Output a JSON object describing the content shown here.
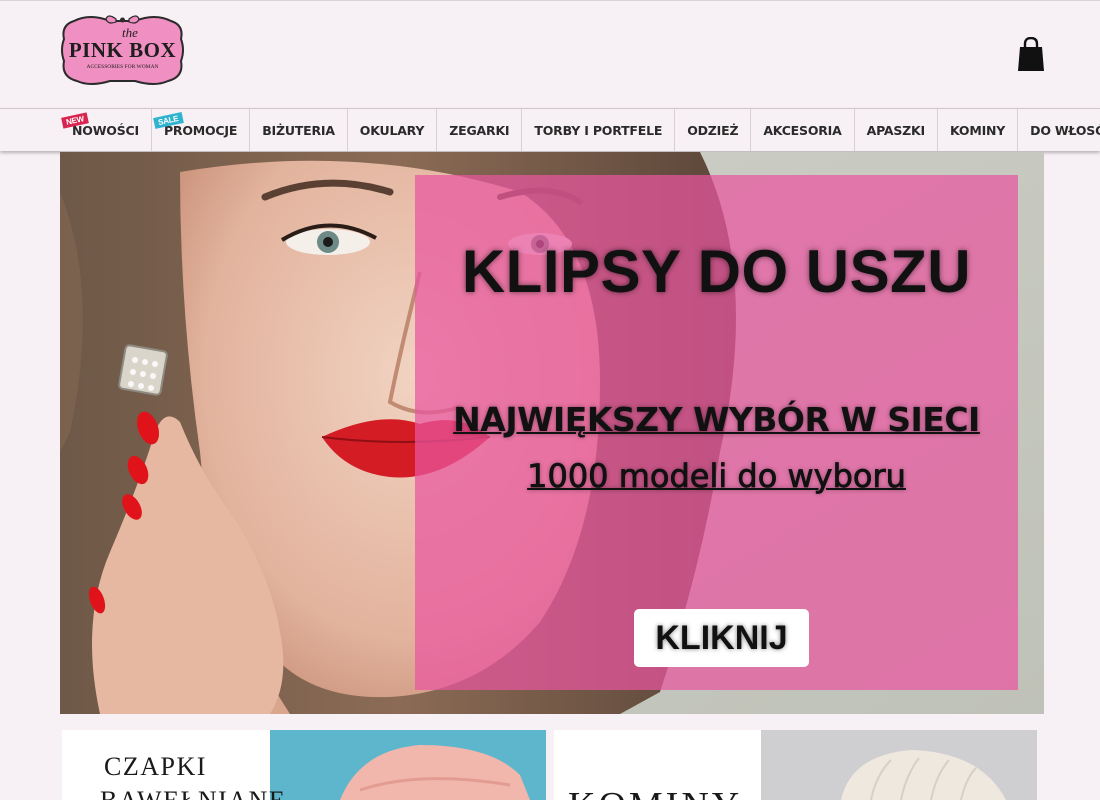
{
  "brand": {
    "logo_the": "the",
    "logo_name": "PINK BOX",
    "logo_tagline": "ACCESSORIES FOR WOMAN"
  },
  "header": {
    "cart_icon": "shopping-bag-icon"
  },
  "nav": {
    "items": [
      {
        "label": "NOWOŚCI",
        "badge": "NEW"
      },
      {
        "label": "PROMOCJE",
        "badge": "SALE"
      },
      {
        "label": "BIŻUTERIA"
      },
      {
        "label": "OKULARY"
      },
      {
        "label": "ZEGARKI"
      },
      {
        "label": "TORBY I PORTFELE"
      },
      {
        "label": "ODZIEŻ"
      },
      {
        "label": "AKCESORIA"
      },
      {
        "label": "APASZKI"
      },
      {
        "label": "KOMINY"
      },
      {
        "label": "DO WŁOSÓW"
      }
    ]
  },
  "hero": {
    "title": "KLIPSY DO USZU",
    "subtitle_1": "NAJWIĘKSZY WYBÓR W SIECI",
    "subtitle_2": "1000 modeli do wyboru",
    "cta": "KLIKNIJ"
  },
  "tiles": [
    {
      "line_1": "CZAPKI",
      "line_2": "BAWEŁNIANE"
    },
    {
      "line_1": "KOMINY"
    }
  ],
  "colors": {
    "page_bg": "#f7f0f4",
    "overlay_pink": "#e956a0",
    "badge_new": "#d8254f",
    "badge_sale": "#2fb3cf",
    "logo_pink": "#f08fc1"
  }
}
